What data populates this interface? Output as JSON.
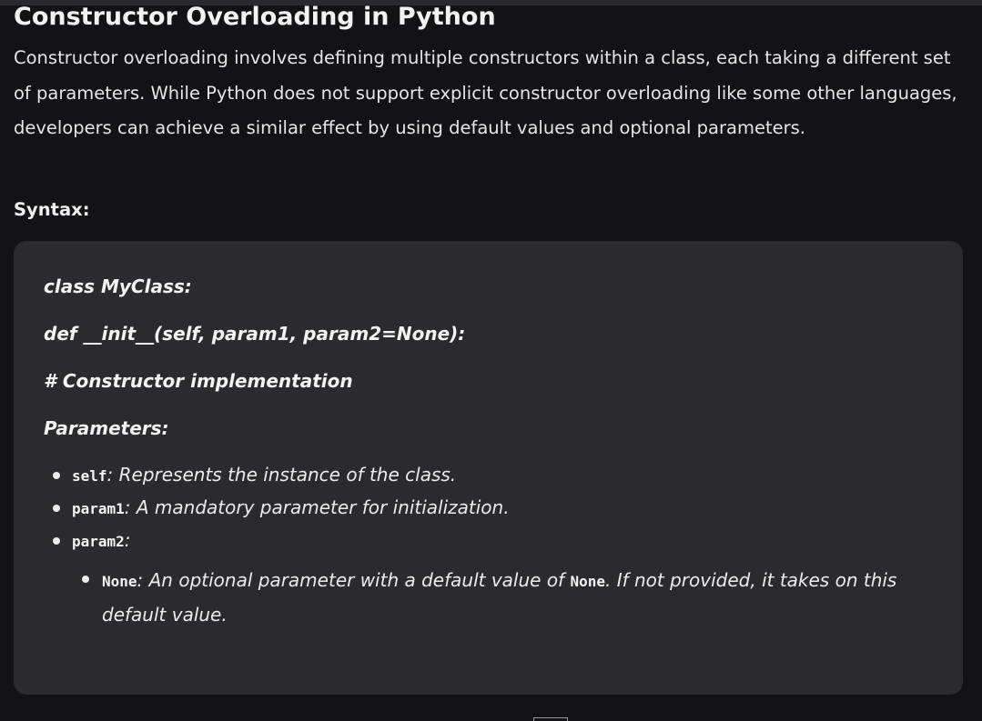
{
  "article": {
    "title": "Constructor Overloading in Python",
    "intro": "Constructor overloading involves defining multiple constructors within a class, each taking a different set of parameters. While Python does not support explicit constructor overloading like some other languages, developers can achieve a similar effect by using default values and optional parameters.",
    "syntax_label": "Syntax:"
  },
  "code_block": {
    "lines": [
      "class MyClass:",
      "def __init__(self, param1, param2=None):",
      "# Constructor implementation",
      "Parameters:"
    ],
    "params": [
      {
        "name": "self",
        "desc": ": Represents the instance of the class."
      },
      {
        "name": "param1",
        "desc": ": A mandatory parameter for initialization."
      },
      {
        "name": "param2",
        "desc": ":"
      }
    ],
    "nested": {
      "name": "None",
      "desc_before": ": An optional parameter with a default value of ",
      "inline_code": "None",
      "desc_after": ". If not provided, it takes on this default value."
    }
  }
}
